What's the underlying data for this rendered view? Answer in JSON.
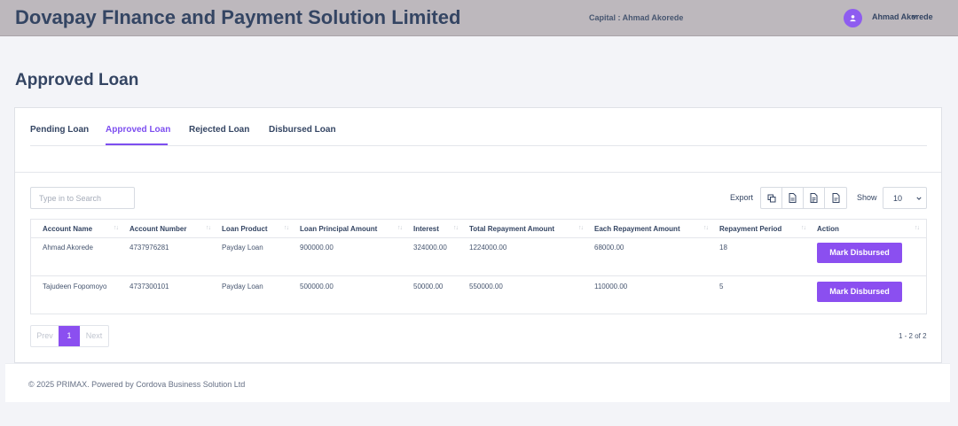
{
  "header": {
    "brand": "Dovapay FInance and Payment Solution Limited",
    "capital": "Capital : Ahmad Akorede",
    "user_name": "Ahmad Akorede"
  },
  "page_title": "Approved Loan",
  "tabs": [
    {
      "label": "Pending Loan",
      "active": false
    },
    {
      "label": "Approved Loan",
      "active": true
    },
    {
      "label": "Rejected Loan",
      "active": false
    },
    {
      "label": "Disbursed Loan",
      "active": false
    }
  ],
  "search": {
    "placeholder": "Type in to Search",
    "value": ""
  },
  "toolbar": {
    "export_label": "Export",
    "export_icons": [
      "copy-icon",
      "csv-file-icon",
      "excel-file-icon",
      "pdf-file-icon"
    ],
    "show_label": "Show",
    "show_value": "10"
  },
  "table": {
    "columns": [
      "Account Name",
      "Account Number",
      "Loan Product",
      "Loan Principal Amount",
      "Interest",
      "Total Repayment Amount",
      "Each Repayment Amount",
      "Repayment Period",
      "Action"
    ],
    "rows": [
      {
        "account_name": "Ahmad Akorede",
        "account_number": "4737976281",
        "loan_product": "Payday Loan",
        "principal": "900000.00",
        "interest": "324000.00",
        "total_repayment": "1224000.00",
        "each_repayment": "68000.00",
        "period": "18",
        "action": "Mark Disbursed"
      },
      {
        "account_name": "Tajudeen Fopomoyo",
        "account_number": "4737300101",
        "loan_product": "Payday Loan",
        "principal": "500000.00",
        "interest": "50000.00",
        "total_repayment": "550000.00",
        "each_repayment": "110000.00",
        "period": "5",
        "action": "Mark Disbursed"
      }
    ]
  },
  "pagination": {
    "prev": "Prev",
    "current": "1",
    "next": "Next",
    "count": "1 - 2 of 2"
  },
  "footer": {
    "text": "© 2025 PRIMAX. Powered by Cordova Business Solution Ltd"
  },
  "colors": {
    "accent": "#8b4ff0",
    "topbar": "#bdb8bd",
    "text": "#344563"
  }
}
